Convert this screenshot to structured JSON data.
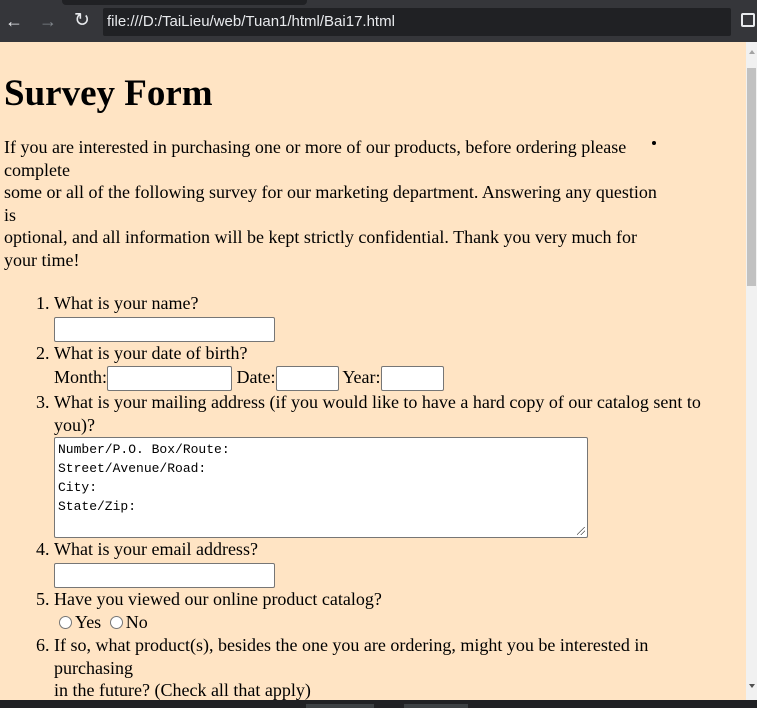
{
  "browser": {
    "url": "file:///D:/TaiLieu/web/Tuan1/html/Bai17.html",
    "back_icon": "←",
    "forward_icon": "→",
    "reload_icon": "↻"
  },
  "page": {
    "title": "Survey Form",
    "intro_lines": [
      "If you are interested in purchasing one or more of our products, before ordering please",
      "complete",
      "some or all of the following survey for our marketing department. Answering any question",
      "is",
      "optional, and all information will be kept strictly confidential. Thank you very much for",
      "your time!"
    ],
    "questions": {
      "q1": {
        "label": "What is your name?",
        "value": ""
      },
      "q2": {
        "label": "What is your date of birth?",
        "month_label": "Month:",
        "date_label": "Date:",
        "year_label": "Year:"
      },
      "q3": {
        "label": "What is your mailing address (if you would like to have a hard copy of our catalog sent to you)?",
        "textarea_value": "Number/P.O. Box/Route:\nStreet/Avenue/Road:\nCity:\nState/Zip:"
      },
      "q4": {
        "label": "What is your email address?",
        "value": ""
      },
      "q5": {
        "label": "Have you viewed our online product catalog?",
        "option_yes": "Yes",
        "option_no": "No"
      },
      "q6": {
        "label_line1": "If so, what product(s), besides the one you are ordering, might you be interested in",
        "label_line2": "purchasing",
        "label_line3": "in the future? (Check all that apply)"
      }
    }
  }
}
